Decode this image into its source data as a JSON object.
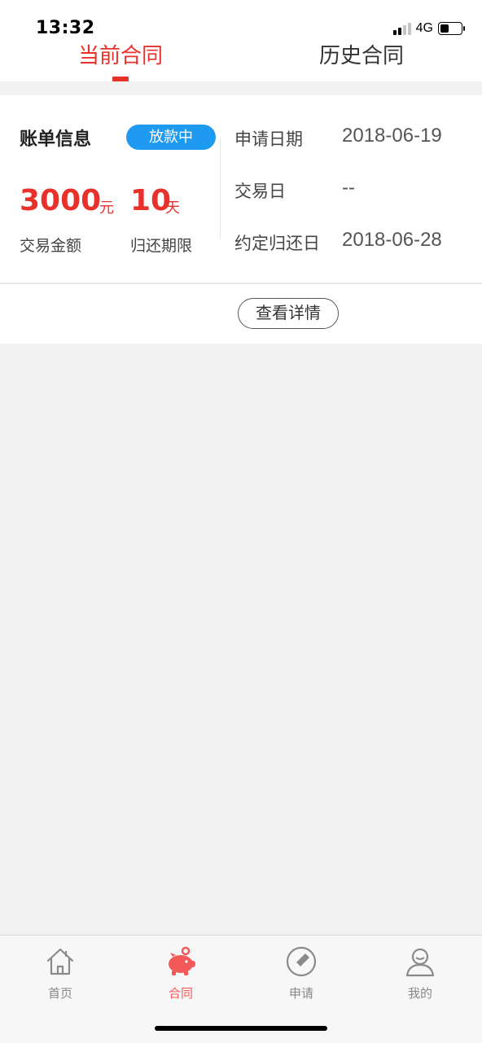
{
  "status_bar": {
    "time": "13:32",
    "network": "4G",
    "battery_level": 0.4
  },
  "tabs": [
    {
      "label": "当前合同",
      "active": true
    },
    {
      "label": "历史合同",
      "active": false
    }
  ],
  "colors": {
    "accent": "#e8312a",
    "badge": "#1e9bf0",
    "nav_active": "#f25a5a"
  },
  "bill": {
    "title": "账单信息",
    "status_badge": "放款中",
    "amount": "3000",
    "amount_unit": "元",
    "amount_label": "交易金额",
    "term": "10",
    "term_unit": "天",
    "term_label": "归还期限",
    "info": [
      {
        "label": "申请日期",
        "value": "2018-06-19"
      },
      {
        "label": "交易日",
        "value": "--"
      },
      {
        "label": "约定归还日",
        "value": "2018-06-28"
      }
    ],
    "detail_button": "查看详情"
  },
  "bottom_nav": [
    {
      "label": "首页",
      "icon": "house-icon",
      "active": false
    },
    {
      "label": "合同",
      "icon": "piggy-bank-icon",
      "active": true
    },
    {
      "label": "申请",
      "icon": "pencil-circle-icon",
      "active": false
    },
    {
      "label": "我的",
      "icon": "user-icon",
      "active": false
    }
  ]
}
